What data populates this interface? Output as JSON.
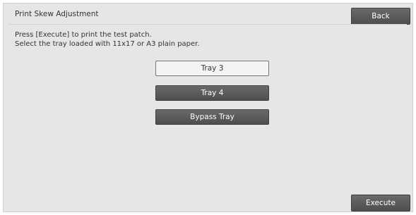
{
  "header": {
    "title": "Print Skew Adjustment",
    "back_label": "Back"
  },
  "instructions": {
    "line1": "Press [Execute] to print the test patch.",
    "line2": "Select the tray loaded with 11x17 or A3 plain paper."
  },
  "trays": [
    {
      "label": "Tray 3",
      "selected": true
    },
    {
      "label": "Tray 4",
      "selected": false
    },
    {
      "label": "Bypass Tray",
      "selected": false
    }
  ],
  "footer": {
    "execute_label": "Execute"
  },
  "colors": {
    "button_dark": "#5a5a5a",
    "button_selected": "#f4f4f4",
    "panel_bg": "#e6e6e6"
  }
}
